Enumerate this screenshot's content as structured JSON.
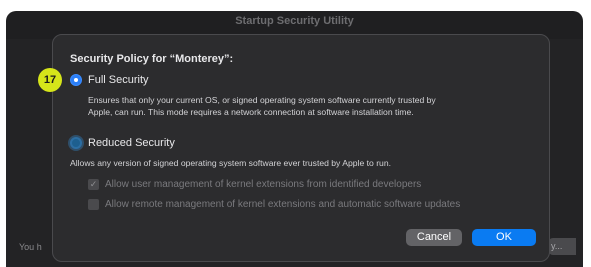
{
  "window": {
    "title": "Startup Security Utility"
  },
  "background": {
    "partial_text": "You h",
    "partial_button": "y..."
  },
  "sheet": {
    "heading": "Security Policy for “Monterey”:",
    "full_security": {
      "label": "Full Security",
      "selected": true,
      "description_line1": "Ensures that only your current OS, or signed operating system software currently trusted by",
      "description_line2": "Apple, can run. This mode requires a network connection at software installation time."
    },
    "reduced_security": {
      "label": "Reduced Security",
      "selected": false,
      "description": "Allows any version of signed operating system software ever trusted by Apple to run."
    },
    "checkboxes": [
      {
        "label": "Allow user management of kernel extensions from identified developers",
        "checked": true,
        "enabled": false
      },
      {
        "label": "Allow remote management of kernel extensions and automatic software updates",
        "checked": false,
        "enabled": false
      }
    ],
    "buttons": {
      "cancel": "Cancel",
      "ok": "OK"
    }
  },
  "annotation": {
    "badge": "17"
  },
  "colors": {
    "accent": "#0a7bf2",
    "badge": "#d6e51a",
    "sheet_bg": "#2c2c2e"
  }
}
